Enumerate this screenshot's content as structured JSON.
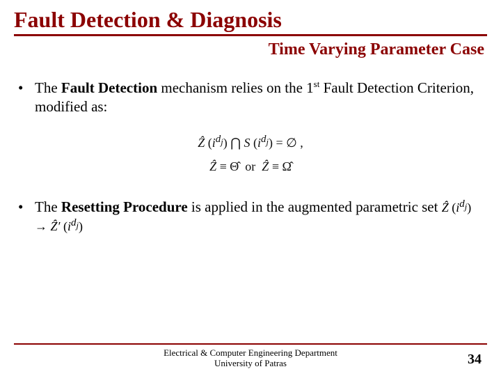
{
  "title": "Fault Detection & Diagnosis",
  "subtitle": "Time Varying Parameter Case",
  "bullet1": {
    "pre": "The ",
    "bold": "Fault Detection",
    "post1": " mechanism relies on the 1",
    "sup": "st",
    "post2": " Fault Detection Criterion, modified as:"
  },
  "equation_block": "Ẑ ( i^{d_j} ) ⋂ S ( i^{d_j} ) = ∅ ,\nẐ ≡ Θ̂  or  Ẑ ≡ Ω̂",
  "bullet2": {
    "pre": "The ",
    "bold": "Resetting Procedure",
    "post": " is applied in the augmented parametric set ",
    "inline_eq": "Ẑ ( i^{d_j} ) → Ẑ′ ( i^{d_j} )"
  },
  "footer": {
    "line1": "Electrical & Computer Engineering Department",
    "line2": "University of Patras"
  },
  "page_number": "34"
}
